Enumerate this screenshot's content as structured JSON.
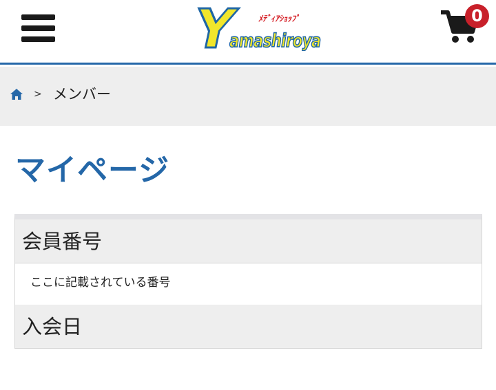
{
  "header": {
    "logo": {
      "text_y": "Y",
      "text_word": "amashiroya",
      "text_tag": "ﾒﾃﾞｨｱｼｮｯﾌﾟ"
    },
    "cart": {
      "count": "0"
    },
    "colors": {
      "accent": "#2467a8",
      "badge": "#c8202a",
      "logo_fill": "#f1e62b"
    }
  },
  "breadcrumb": {
    "separator": ">",
    "current": "メンバー"
  },
  "page": {
    "title": "マイページ"
  },
  "member_table": {
    "rows": [
      {
        "label": "会員番号",
        "value": "ここに記載されている番号"
      },
      {
        "label": "入会日",
        "value": ""
      }
    ]
  }
}
